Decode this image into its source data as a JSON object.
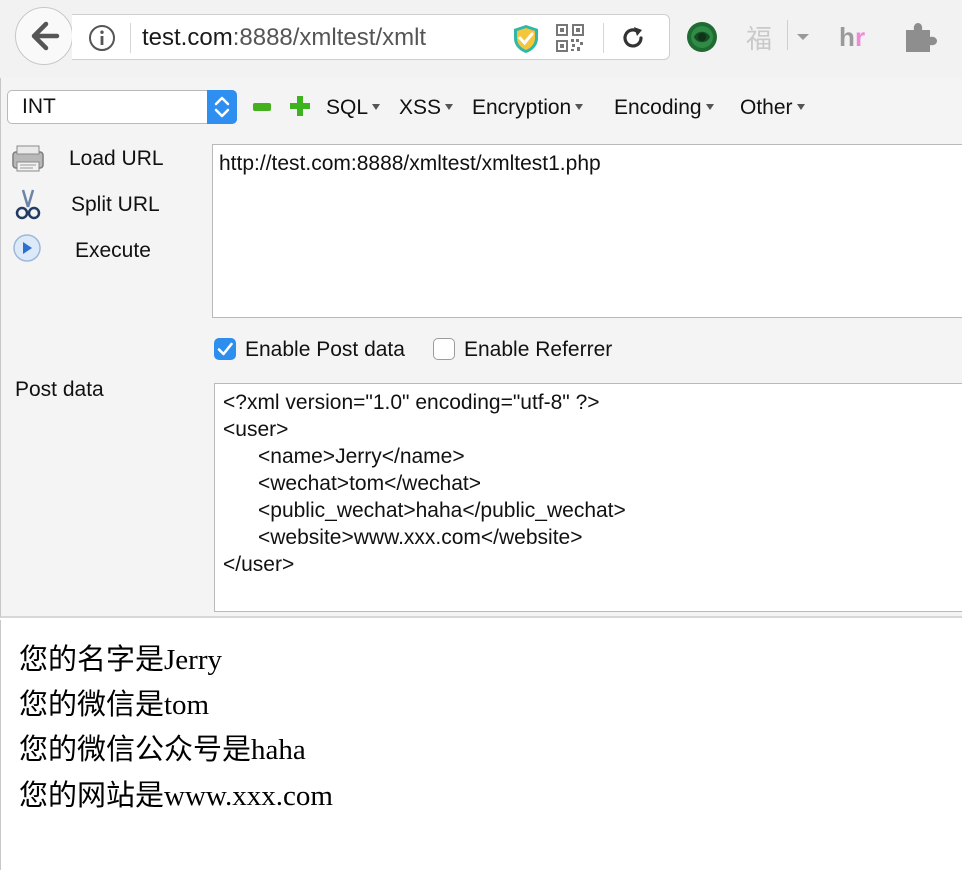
{
  "browser": {
    "url_host": "test.com",
    "url_rest": ":8888/xmltest/xmlt",
    "extensions": [
      "green-orb-extension",
      "fu-extension",
      "hr-extension",
      "puzzle-extension"
    ]
  },
  "hackbar": {
    "select_value": "INT",
    "menus": [
      "SQL",
      "XSS",
      "Encryption",
      "Encoding",
      "Other"
    ],
    "buttons": {
      "load_url": "Load URL",
      "split_url": "Split URL",
      "execute": "Execute"
    },
    "url_value": "http://test.com:8888/xmltest/xmltest1.php",
    "enable_post": {
      "label": "Enable Post data",
      "checked": true
    },
    "enable_referrer": {
      "label": "Enable Referrer",
      "checked": false
    },
    "post_label": "Post data",
    "post_lines": [
      "<?xml version=\"1.0\" encoding=\"utf-8\" ?>",
      "<user>",
      "      <name>Jerry</name>",
      "      <wechat>tom</wechat>",
      "      <public_wechat>haha</public_wechat>",
      "      <website>www.xxx.com</website>",
      "</user>"
    ]
  },
  "output": {
    "lines": [
      "您的名字是Jerry",
      "您的微信是tom",
      "您的微信公众号是haha",
      "您的网站是www.xxx.com"
    ]
  },
  "colors": {
    "accent": "#2f8ff0",
    "plus_green": "#3db31f",
    "minus_green": "#45b01e"
  }
}
